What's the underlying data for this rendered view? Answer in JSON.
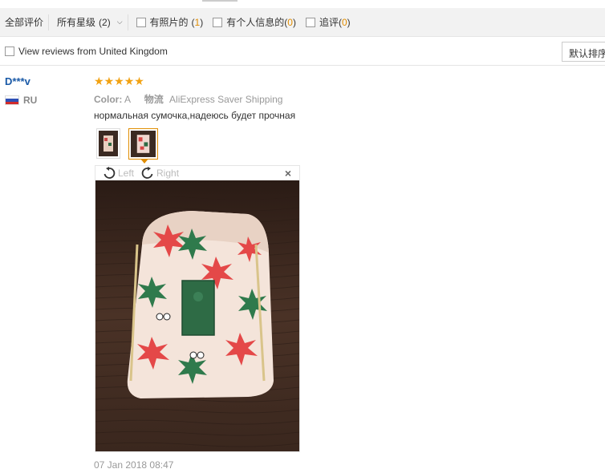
{
  "filters": {
    "all_reviews": "全部评价",
    "all_stars": "所有星级",
    "all_stars_count": "(2)",
    "with_photos": "有照片的",
    "with_photos_open": "(",
    "with_photos_count": "1",
    "with_photos_close": ")",
    "with_personal_info": "有个人信息的",
    "with_personal_info_open": "(",
    "with_personal_info_count": "0",
    "with_personal_info_close": ")",
    "followup": "追评",
    "followup_open": "(",
    "followup_count": "0",
    "followup_close": ")"
  },
  "country_filter": {
    "label": "View reviews from United Kingdom"
  },
  "sort": {
    "label": "默认排序"
  },
  "review": {
    "user": "D***v",
    "country": "RU",
    "rating": 5,
    "color_key": "Color:",
    "color_value": "A",
    "logistics_key": "物流",
    "logistics_value": "AliExpress Saver Shipping",
    "text": "нормальная сумочка,надеюсь будет прочная",
    "date": "07 Jan 2018 08:47"
  },
  "viewer": {
    "rotate_left": "Left",
    "rotate_right": "Right",
    "close": "×"
  },
  "colors": {
    "accent": "#e08c00",
    "username": "#1a5aa7",
    "star": "#f2a212"
  },
  "icons": [
    "rotate-left-icon",
    "rotate-right-icon",
    "close-icon",
    "chevron-down-icon",
    "russia-flag-icon"
  ]
}
